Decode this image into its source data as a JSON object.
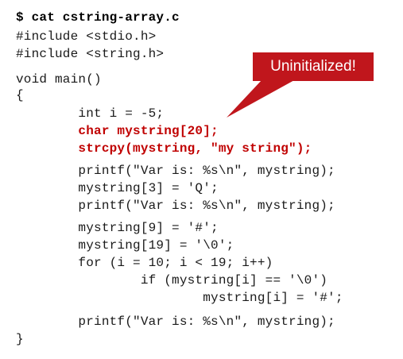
{
  "command": "$ cat cstring-array.c",
  "code_lines": [
    "#include <stdio.h>",
    "#include <string.h>",
    "",
    "void main()",
    "{",
    "        int i = -5;",
    "        char mystring[20];",
    "        strcpy(mystring, \"my string\");",
    "",
    "        printf(\"Var is: %s\\n\", mystring);",
    "        mystring[3] = 'Q';",
    "        printf(\"Var is: %s\\n\", mystring);",
    "",
    "        mystring[9] = '#';",
    "        mystring[19] = '\\0';",
    "        for (i = 10; i < 19; i++)",
    "                if (mystring[i] == '\\0')",
    "                        mystring[i] = '#';",
    "",
    "        printf(\"Var is: %s\\n\", mystring);",
    "}"
  ],
  "callout": {
    "text": "Uninitialized!",
    "color": "#c0161c"
  },
  "highlight_color": "#c00000"
}
